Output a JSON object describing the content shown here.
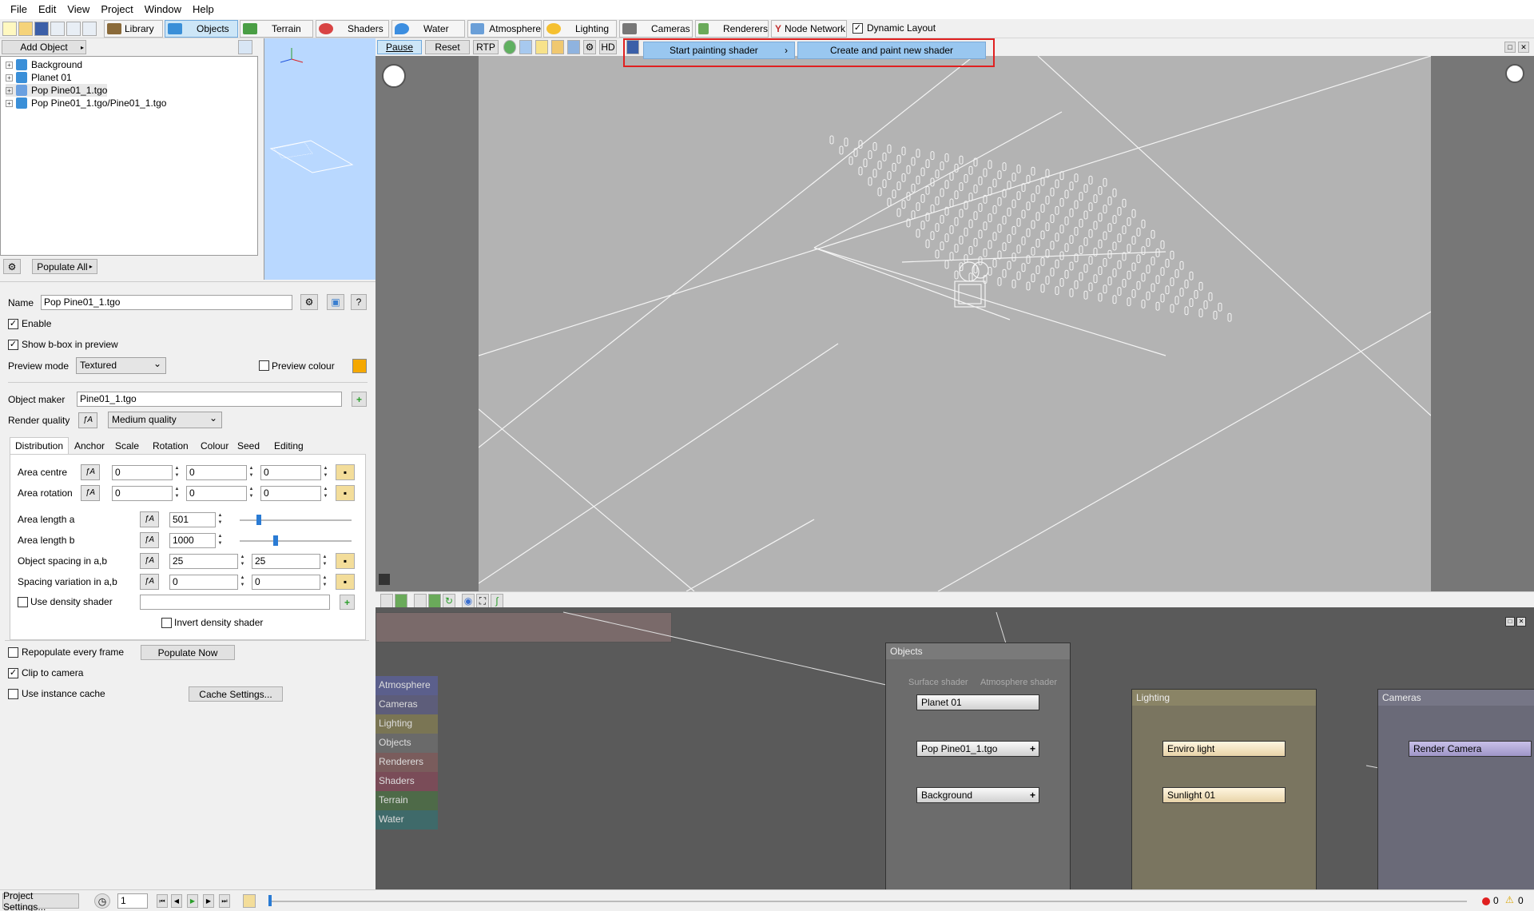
{
  "menubar": [
    "File",
    "Edit",
    "View",
    "Project",
    "Window",
    "Help"
  ],
  "toolbar": {
    "library": "Library",
    "objects": "Objects",
    "terrain": "Terrain",
    "shaders": "Shaders",
    "water": "Water",
    "atmosphere": "Atmosphere",
    "lighting": "Lighting",
    "cameras": "Cameras",
    "renderers": "Renderers",
    "node_network": "Node Network",
    "dynamic_layout": "Dynamic Layout"
  },
  "objects_panel": {
    "add_object": "Add Object",
    "tree": [
      "Background",
      "Planet 01",
      "Pop Pine01_1.tgo",
      "Pop Pine01_1.tgo/Pine01_1.tgo"
    ],
    "populate_all": "Populate All"
  },
  "props": {
    "name_label": "Name",
    "name_value": "Pop Pine01_1.tgo",
    "enable": "Enable",
    "show_bbox": "Show b-box in preview",
    "preview_mode_label": "Preview mode",
    "preview_mode_value": "Textured",
    "preview_colour": "Preview colour",
    "preview_colour_hex": "#f5a800",
    "object_maker_label": "Object maker",
    "object_maker_value": "Pine01_1.tgo",
    "render_quality_label": "Render quality",
    "render_quality_value": "Medium quality",
    "tabs": [
      "Distribution",
      "Anchor",
      "Scale",
      "Rotation",
      "Colour",
      "Seed",
      "Editing"
    ],
    "area_centre": "Area centre",
    "area_centre_vals": [
      "0",
      "0",
      "0"
    ],
    "area_rotation": "Area rotation",
    "area_rotation_vals": [
      "0",
      "0",
      "0"
    ],
    "area_length_a": "Area length a",
    "area_length_a_val": "501",
    "area_length_a_level": 0.15,
    "area_length_b": "Area length b",
    "area_length_b_val": "1000",
    "area_length_b_level": 0.3,
    "object_spacing": "Object spacing in a,b",
    "object_spacing_vals": [
      "25",
      "25"
    ],
    "spacing_variation": "Spacing variation in a,b",
    "spacing_variation_vals": [
      "0",
      "0"
    ],
    "use_density": "Use density shader",
    "invert_density": "Invert density shader",
    "repopulate": "Repopulate every frame",
    "populate_now": "Populate Now",
    "clip_camera": "Clip to camera",
    "use_instance": "Use instance cache",
    "cache_settings": "Cache Settings..."
  },
  "viewport": {
    "pause": "Pause",
    "reset": "Reset",
    "rtp": "RTP",
    "hd": "HD",
    "menu_start": "Start painting shader",
    "menu_create": "Create and paint new shader"
  },
  "nodes": {
    "categories": [
      {
        "label": "Atmosphere",
        "color": "#5b5f8c"
      },
      {
        "label": "Cameras",
        "color": "#5d5d7a"
      },
      {
        "label": "Lighting",
        "color": "#7a7554"
      },
      {
        "label": "Objects",
        "color": "#6a6a6a"
      },
      {
        "label": "Renderers",
        "color": "#7a5c5c"
      },
      {
        "label": "Shaders",
        "color": "#7a4c58"
      },
      {
        "label": "Terrain",
        "color": "#4e6a48"
      },
      {
        "label": "Water",
        "color": "#3f6a6a"
      }
    ],
    "objects_group": "Objects",
    "surface_shader": "Surface shader",
    "atmosphere_shader": "Atmosphere shader",
    "planet": "Planet 01",
    "pop": "Pop Pine01_1.tgo",
    "background": "Background",
    "lighting_group": "Lighting",
    "enviro": "Enviro light",
    "sunlight": "Sunlight 01",
    "cameras_group": "Cameras",
    "render_camera": "Render Camera"
  },
  "status": {
    "project_settings": "Project Settings...",
    "frame": "1",
    "errors": "0",
    "warnings": "0"
  }
}
